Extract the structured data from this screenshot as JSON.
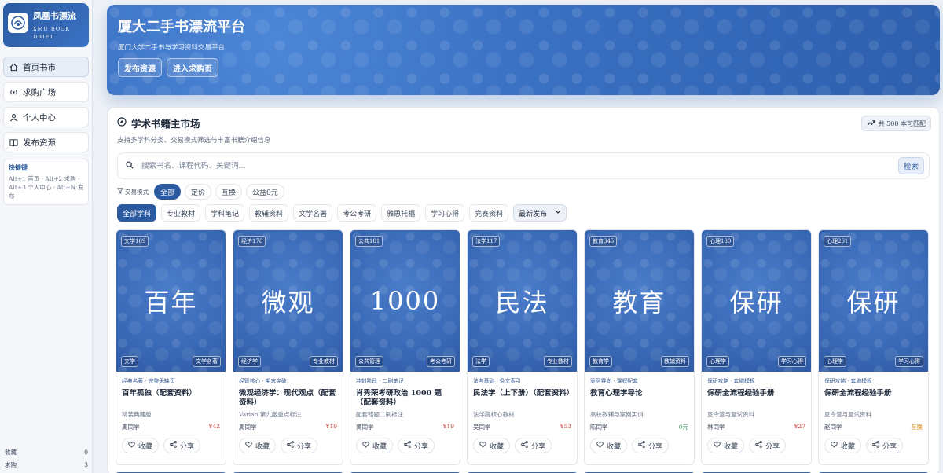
{
  "brand": {
    "title": "凤凰书漂流",
    "sub": "XMU BOOK DRIFT"
  },
  "nav": [
    {
      "label": "首页书市",
      "icon": "home-icon"
    },
    {
      "label": "求购广场",
      "icon": "broadcast-icon"
    },
    {
      "label": "个人中心",
      "icon": "user-icon"
    },
    {
      "label": "发布资源",
      "icon": "book-icon"
    }
  ],
  "shortcuts": {
    "title": "快捷键",
    "text": "Alt+1 首页 · Alt+2 求购 · Alt+3 个人中心 · Alt+N 发布"
  },
  "side_stats": [
    {
      "label": "收藏",
      "value": "0"
    },
    {
      "label": "求购",
      "value": "3"
    }
  ],
  "hero": {
    "title": "厦大二手书漂流平台",
    "subtitle": "厦门大学二手书与学习资料交易平台",
    "btn_publish": "发布资源",
    "btn_wanted": "进入求购页"
  },
  "market": {
    "title": "学术书籍主市场",
    "subtitle": "支持多学科分类、交易模式筛选与丰富书籍介绍信息",
    "count": "共 500 本可匹配",
    "search_placeholder": "搜索书名、课程代码、关键词...",
    "search_btn": "检索",
    "mode_label": "交易模式",
    "modes": [
      "全部",
      "定价",
      "互换",
      "公益0元"
    ],
    "categories": [
      "全部学科",
      "专业教材",
      "学科笔记",
      "教辅资料",
      "文学名著",
      "考公考研",
      "雅思托福",
      "学习心得",
      "竞赛资料"
    ],
    "sort": "最新发布"
  },
  "books": [
    {
      "cover": "百年",
      "badge": "文学169",
      "foot_l": "文学",
      "foot_r": "文学名著",
      "tag": "经典名著 · 完整无缺页",
      "title": "百年孤独（配套资料）",
      "desc": "精装典藏版",
      "user": "周同学",
      "price": "¥42",
      "price_type": "red"
    },
    {
      "cover": "微观",
      "badge": "经济178",
      "foot_l": "经济学",
      "foot_r": "专业教材",
      "tag": "经管核心 · 期末突破",
      "title": "微观经济学：现代观点（配套资料）",
      "desc": "Varian 第九版重点标注",
      "user": "周同学",
      "price": "¥19",
      "price_type": "red"
    },
    {
      "cover": "1000",
      "badge": "公共181",
      "foot_l": "公共管理",
      "foot_r": "考公考研",
      "tag": "冲刺阶段 · 二刷笔记",
      "title": "肖秀荣考研政治 1000 题（配套资料）",
      "desc": "配套错题二刷标注",
      "user": "黄同学",
      "price": "¥19",
      "price_type": "red"
    },
    {
      "cover": "民法",
      "badge": "法学117",
      "foot_l": "法学",
      "foot_r": "专业教材",
      "tag": "法考基础 · 条文索引",
      "title": "民法学（上下册）（配套资料）",
      "desc": "法学院核心教材",
      "user": "吴同学",
      "price": "¥53",
      "price_type": "red"
    },
    {
      "cover": "教育",
      "badge": "教育345",
      "foot_l": "教育学",
      "foot_r": "教辅资料",
      "tag": "案例导向 · 课程配套",
      "title": "教育心理学导论",
      "desc": "高校教辅与案例实训",
      "user": "陈同学",
      "price": "0元",
      "price_type": "green"
    },
    {
      "cover": "保研",
      "badge": "心理130",
      "foot_l": "心理学",
      "foot_r": "学习心得",
      "tag": "保研攻略 · 套磁模板",
      "title": "保研全流程经验手册",
      "desc": "夏令营与复试资料",
      "user": "林同学",
      "price": "¥27",
      "price_type": "red"
    },
    {
      "cover": "保研",
      "badge": "心理261",
      "foot_l": "心理学",
      "foot_r": "学习心得",
      "tag": "保研攻略 · 套磁模板",
      "title": "保研全流程经验手册",
      "desc": "夏令营与复试资料",
      "user": "赵同学",
      "price": "互换",
      "price_type": "orange"
    }
  ],
  "actions": {
    "fav": "收藏",
    "share": "分享"
  }
}
